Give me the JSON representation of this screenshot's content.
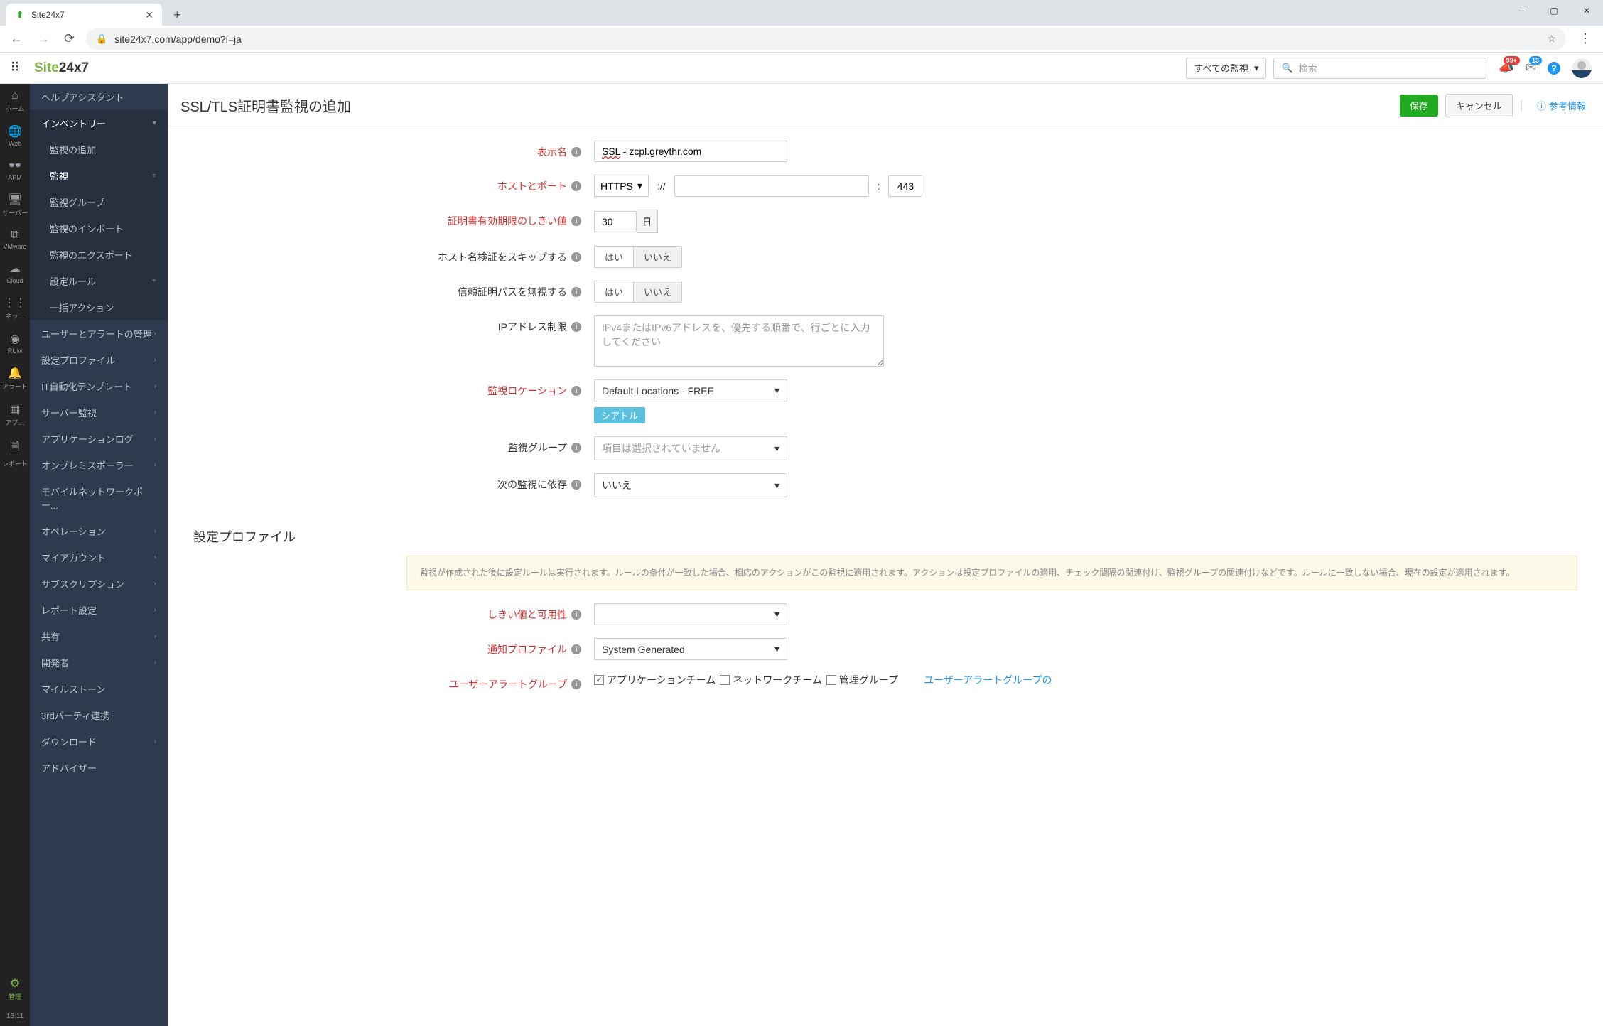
{
  "browser": {
    "tab_title": "Site24x7",
    "url": "site24x7.com/app/demo?l=ja"
  },
  "header": {
    "logo_site": "Site",
    "logo_247": "24x7",
    "monitor_dropdown": "すべての監視",
    "search_placeholder": "検索",
    "badge1": "99+",
    "badge2": "13"
  },
  "rail": [
    {
      "icon": "⌂",
      "label": "ホーム"
    },
    {
      "icon": "🌐",
      "label": "Web"
    },
    {
      "icon": "👓",
      "label": "APM"
    },
    {
      "icon": "🖥",
      "label": "サーバー"
    },
    {
      "icon": "⧉",
      "label": "VMware"
    },
    {
      "icon": "☁",
      "label": "Cloud"
    },
    {
      "icon": "⋮⋮",
      "label": "ネッ…"
    },
    {
      "icon": "◉",
      "label": "RUM"
    },
    {
      "icon": "🔔",
      "label": "アラート"
    },
    {
      "icon": "▦",
      "label": "アプ…"
    },
    {
      "icon": "🗎",
      "label": "レポート"
    }
  ],
  "rail_admin": {
    "icon": "⚙",
    "label": "管理"
  },
  "rail_time": "16:11",
  "sidebar": {
    "help": "ヘルプアシスタント",
    "inventory": "インベントリー",
    "inventory_sub": [
      "監視の追加",
      "監視",
      "監視グループ",
      "監視のインポート",
      "監視のエクスポート",
      "設定ルール",
      "一括アクション"
    ],
    "rest": [
      "ユーザーとアラートの管理",
      "設定プロファイル",
      "IT自動化テンプレート",
      "サーバー監視",
      "アプリケーションログ",
      "オンプレミスポーラー",
      "モバイルネットワークポー...",
      "オペレーション",
      "マイアカウント",
      "サブスクリプション",
      "レポート設定",
      "共有",
      "開発者",
      "マイルストーン",
      "3rdパーティ連携",
      "ダウンロード",
      "アドバイザー"
    ]
  },
  "page": {
    "title": "SSL/TLS証明書監視の追加",
    "save": "保存",
    "cancel": "キャンセル",
    "reference": "参考情報"
  },
  "form": {
    "display_name_label": "表示名",
    "display_name_prefix": "SSL",
    "display_name_value": " - zcpl.greythr.com",
    "host_port_label": "ホストとポート",
    "protocol": "HTTPS",
    "proto_sep": "://",
    "host": "",
    "port_sep": ":",
    "port": "443",
    "cert_threshold_label": "証明書有効期限のしきい値",
    "cert_threshold_value": "30",
    "cert_threshold_unit": "日",
    "skip_hostname_label": "ホスト名検証をスキップする",
    "ignore_trust_label": "信頼証明パスを無視する",
    "toggle_yes": "はい",
    "toggle_no": "いいえ",
    "ip_restrict_label": "IPアドレス制限",
    "ip_restrict_placeholder": "IPv4またはIPv6アドレスを、優先する順番で、行ごとに入力してください",
    "location_label": "監視ロケーション",
    "location_value": "Default Locations - FREE",
    "location_tag": "シアトル",
    "group_label": "監視グループ",
    "group_placeholder": "項目は選択されていません",
    "depend_label": "次の監視に依存",
    "depend_value": "いいえ"
  },
  "section2": {
    "title": "設定プロファイル",
    "notice": "監視が作成された後に設定ルールは実行されます。ルールの条件が一致した場合、相応のアクションがこの監視に適用されます。アクションは設定プロファイルの適用、チェック間隔の関連付け、監視グループの関連付けなどです。ルールに一致しない場合、現在の設定が適用されます。",
    "threshold_label": "しきい値と可用性",
    "notify_label": "通知プロファイル",
    "notify_value": "System Generated",
    "alert_group_label": "ユーザーアラートグループ",
    "cb1": "アプリケーションチーム",
    "cb2": "ネットワークチーム",
    "cb3": "管理グループ",
    "alert_link": "ユーザーアラートグループの"
  }
}
